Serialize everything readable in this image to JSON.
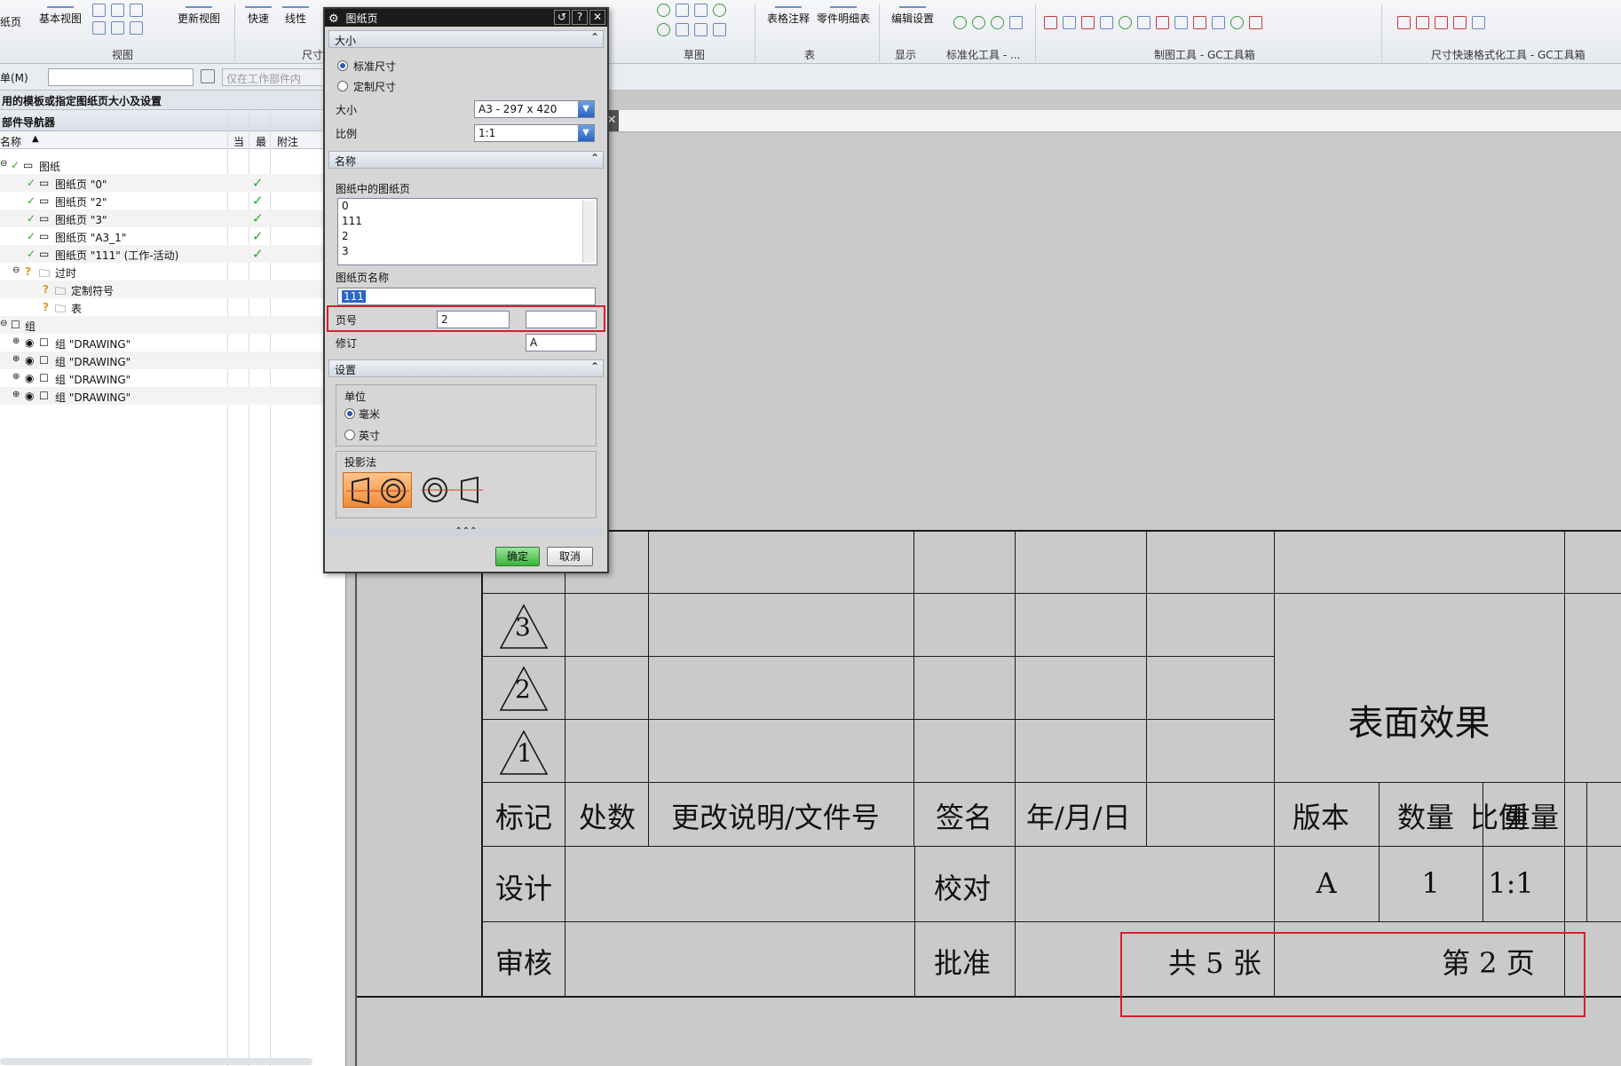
{
  "ribbon": {
    "buttons": [
      "基本视图",
      "更新视图",
      "快速",
      "线性",
      "表格注释",
      "零件明细表",
      "编辑设置"
    ],
    "left_edge_label": "纸页",
    "groups": [
      "视图",
      "尺寸",
      "草图",
      "表",
      "显示",
      "标准化工具 - ...",
      "制图工具 - GC工具箱",
      "尺寸快速格式化工具 - GC工具箱"
    ]
  },
  "cmdbar": {
    "menu": "单(M)",
    "filter_placeholder": "仅在工作部件内"
  },
  "prompt": "用的模板或指定图纸页大小及设置",
  "navigator": {
    "title": "部件导航器",
    "columns": [
      "名称",
      "当",
      "最",
      "附注"
    ],
    "rows": [
      {
        "label": "图纸",
        "checked": false
      },
      {
        "label": "图纸页 \"0\"",
        "checked": true
      },
      {
        "label": "图纸页 \"2\"",
        "checked": true
      },
      {
        "label": "图纸页 \"3\"",
        "checked": true
      },
      {
        "label": "图纸页 \"A3_1\"",
        "checked": true
      },
      {
        "label": "图纸页 \"111\" (工作-活动)",
        "checked": true
      },
      {
        "label": "过时",
        "checked": false
      },
      {
        "label": "定制符号",
        "checked": false
      },
      {
        "label": "表",
        "checked": false
      },
      {
        "label": "组",
        "checked": false
      },
      {
        "label": "组 \"DRAWING\"",
        "checked": false
      },
      {
        "label": "组 \"DRAWING\"",
        "checked": false
      },
      {
        "label": "组 \"DRAWING\"",
        "checked": false
      },
      {
        "label": "组 \"DRAWING\"",
        "checked": false
      }
    ]
  },
  "dialog": {
    "title": "图纸页",
    "size_section": "大小",
    "radio_standard": "标准尺寸",
    "radio_custom": "定制尺寸",
    "size_label": "大小",
    "size_value": "A3 - 297 x 420",
    "scale_label": "比例",
    "scale_value": "1:1",
    "name_section": "名称",
    "sheets_label": "图纸中的图纸页",
    "sheets": [
      "0",
      "111",
      "2",
      "3"
    ],
    "sheet_name_label": "图纸页名称",
    "sheet_name_value": "111",
    "page_label": "页号",
    "page_value": "2",
    "page_value2": "",
    "revision_label": "修订",
    "revision_value": "A",
    "settings_section": "设置",
    "units_label": "单位",
    "unit_mm": "毫米",
    "unit_inch": "英寸",
    "projection_label": "投影法",
    "ok": "确定",
    "cancel": "取消"
  },
  "titleblock": {
    "triangles": [
      "3",
      "2",
      "1"
    ],
    "header": [
      "标记",
      "处数",
      "更改说明/文件号",
      "签名",
      "年/月/日",
      "版本",
      "数量",
      "重量",
      "比例"
    ],
    "row_design": "设计",
    "row_check": "校对",
    "row_review": "审核",
    "row_approve": "批准",
    "version": "A",
    "quantity": "1",
    "scale": "1:1",
    "title": "表面效果",
    "total_sheets": "共 5 张",
    "page_no": "第 2 页"
  }
}
